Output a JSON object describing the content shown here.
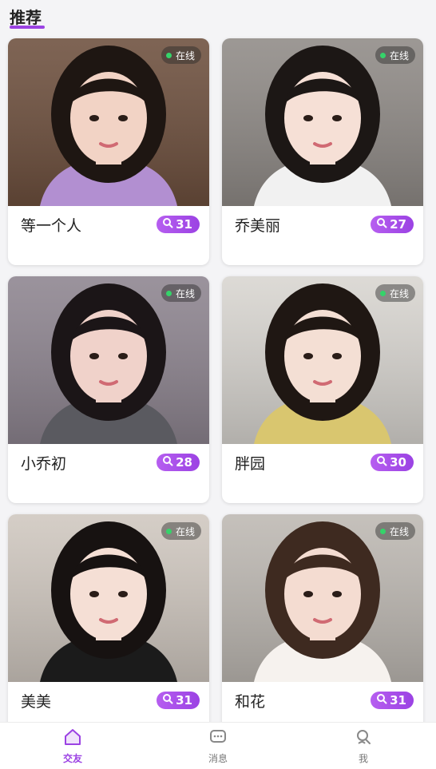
{
  "header": {
    "title": "推荐"
  },
  "cards": [
    {
      "name": "等一个人",
      "status": "在线",
      "count": "31",
      "palette": {
        "bg": "#6d4f3d",
        "hair": "#1e1612",
        "skin": "#f2d3c5",
        "cloth": "#b28fd1"
      }
    },
    {
      "name": "乔美丽",
      "status": "在线",
      "count": "27",
      "palette": {
        "bg": "#8f8a86",
        "hair": "#1c1715",
        "skin": "#f6e0d6",
        "cloth": "#f1f1f1"
      }
    },
    {
      "name": "小乔初",
      "status": "在线",
      "count": "28",
      "palette": {
        "bg": "#8d848f",
        "hair": "#1b1517",
        "skin": "#f0d2ca",
        "cloth": "#5a5a60"
      }
    },
    {
      "name": "胖园",
      "status": "在线",
      "count": "30",
      "palette": {
        "bg": "#d8d5d0",
        "hair": "#1f1713",
        "skin": "#f4dfd4",
        "cloth": "#d9c66f"
      }
    },
    {
      "name": "美美",
      "status": "在线",
      "count": "31",
      "palette": {
        "bg": "#cfc7bf",
        "hair": "#171211",
        "skin": "#f5dfd5",
        "cloth": "#1b1b1b"
      }
    },
    {
      "name": "和花",
      "status": "在线",
      "count": "31",
      "palette": {
        "bg": "#bdb8b2",
        "hair": "#3e2a20",
        "skin": "#f4dcd1",
        "cloth": "#f6f2ee"
      }
    }
  ],
  "tabs": [
    {
      "label": "交友",
      "icon": "home-icon",
      "active": true
    },
    {
      "label": "消息",
      "icon": "chat-icon",
      "active": false
    },
    {
      "label": "我",
      "icon": "profile-icon",
      "active": false
    }
  ],
  "colors": {
    "accent": "#9b42e3",
    "online": "#35d36a"
  }
}
